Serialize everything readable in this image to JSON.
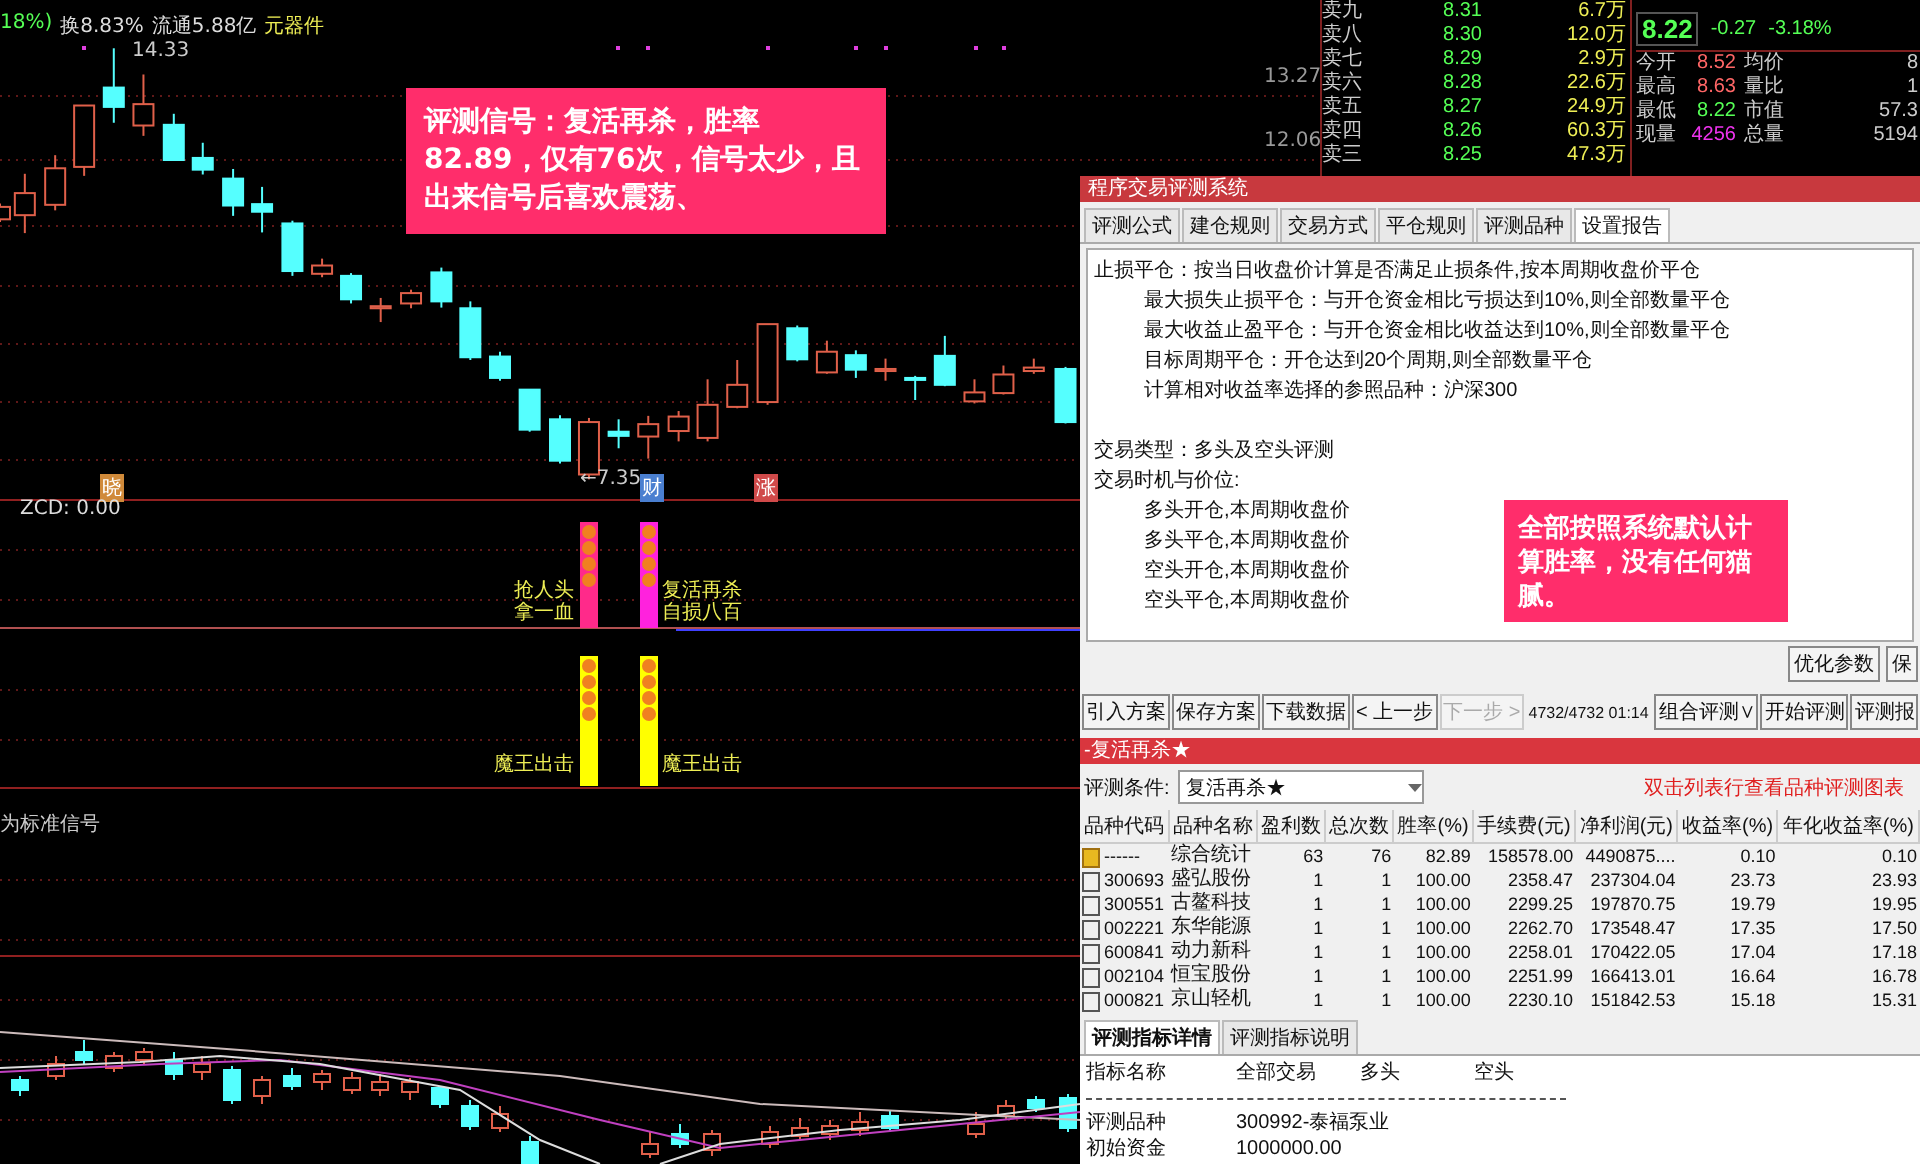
{
  "chart": {
    "header": [
      {
        "text": "18%)",
        "kind": "change"
      },
      {
        "text": "换8.83%",
        "kind": "plain"
      },
      {
        "text": "流通5.88亿",
        "kind": "plain"
      },
      {
        "text": "元器件",
        "kind": "sector"
      }
    ],
    "high_label": "14.33",
    "low_label": "←7.35",
    "axis_labels": [
      "13.27",
      "12.06"
    ],
    "markers": [
      {
        "text": "晓",
        "color": "#d08a3a"
      },
      {
        "text": "财",
        "color": "#4a7fd0"
      },
      {
        "text": "涨",
        "color": "#d04a4a"
      }
    ],
    "note": "评测信号：复活再杀，胜率82.89，仅有76次，信号太少，且出来信号后喜欢震荡、"
  },
  "indicator": {
    "title": "ZCD: 0.00",
    "signals": [
      {
        "line1": "抢人头",
        "line2": "拿一血",
        "color": "#ff2a8a"
      },
      {
        "line1": "复活再杀",
        "line2": "自损八百",
        "color": "#ff22dd"
      }
    ],
    "lower_signals": [
      "魔王出击",
      "魔王出击"
    ],
    "caption": "为标准信号"
  },
  "quote": {
    "asks": [
      {
        "label": "卖九",
        "price": "8.31",
        "volume": "6.7万"
      },
      {
        "label": "卖八",
        "price": "8.30",
        "volume": "12.0万"
      },
      {
        "label": "卖七",
        "price": "8.29",
        "volume": "2.9万"
      },
      {
        "label": "卖六",
        "price": "8.28",
        "volume": "22.6万"
      },
      {
        "label": "卖五",
        "price": "8.27",
        "volume": "24.9万"
      },
      {
        "label": "卖四",
        "price": "8.26",
        "volume": "60.3万"
      },
      {
        "label": "卖三",
        "price": "8.25",
        "volume": "47.3万"
      }
    ],
    "price": "8.22",
    "change": "-0.27",
    "percent": "-3.18%",
    "stats": [
      {
        "label": "今开",
        "value": "8.52",
        "color": "#ff6666",
        "label2": "均价",
        "value2": "8"
      },
      {
        "label": "最高",
        "value": "8.63",
        "color": "#ff6666",
        "label2": "量比",
        "value2": "1"
      },
      {
        "label": "最低",
        "value": "8.22",
        "color": "#55ff55",
        "label2": "市值",
        "value2": "57.3"
      },
      {
        "label": "现量",
        "value": "4256",
        "color": "#ee33ee",
        "label2": "总量",
        "value2": "5194"
      }
    ]
  },
  "dialog": {
    "title": "程序交易评测系统",
    "tabs": [
      {
        "label": "评测公式",
        "selected": false
      },
      {
        "label": "建仓规则",
        "selected": false
      },
      {
        "label": "交易方式",
        "selected": false
      },
      {
        "label": "平仓规则",
        "selected": false
      },
      {
        "label": "评测品种",
        "selected": false
      },
      {
        "label": "设置报告",
        "selected": true
      }
    ],
    "report_lines": [
      {
        "text": "止损平仓：按当日收盘价计算是否满足止损条件,按本周期收盘价平仓",
        "kind": "heading"
      },
      {
        "text": "最大损失止损平仓：与开仓资金相比亏损达到10%,则全部数量平仓",
        "kind": "item"
      },
      {
        "text": "最大收益止盈平仓：与开仓资金相比收益达到10%,则全部数量平仓",
        "kind": "item"
      },
      {
        "text": "目标周期平仓：开仓达到20个周期,则全部数量平仓",
        "kind": "item"
      },
      {
        "text": "计算相对收益率选择的参照品种：沪深300",
        "kind": "item"
      },
      {
        "text": "交易类型：多头及空头评测",
        "kind": "section"
      },
      {
        "text": "交易时机与价位:",
        "kind": "heading"
      },
      {
        "text": "多头开仓,本周期收盘价",
        "kind": "item"
      },
      {
        "text": "多头平仓,本周期收盘价",
        "kind": "item"
      },
      {
        "text": "空头开仓,本周期收盘价",
        "kind": "item"
      },
      {
        "text": "空头平仓,本周期收盘价",
        "kind": "item"
      }
    ],
    "note": "全部按照系统默认计算胜率，没有任何猫腻。",
    "panel_buttons": [
      "优化参数",
      "保"
    ],
    "toolbar": [
      {
        "label": "引入方案",
        "disabled": false
      },
      {
        "label": "保存方案",
        "disabled": false
      },
      {
        "label": "下载数据",
        "disabled": false
      },
      {
        "label": "< 上一步",
        "disabled": false
      },
      {
        "label": "下一步 >",
        "disabled": true
      }
    ],
    "progress": "4732/4732  01:14",
    "toolbar_right": [
      "组合评测∨",
      "开始评测",
      "评测报"
    ],
    "strategy_bar": "-复活再杀★",
    "condition": {
      "label": "评测条件:",
      "value": "复活再杀★",
      "hint": "双击列表行查看品种评测图表"
    },
    "table": {
      "columns": [
        "品种代码",
        "品种名称",
        "盈利数",
        "总次数",
        "胜率(%)",
        "手续费(元)",
        "净利润(元)",
        "收益率(%)",
        "年化收益率(%)"
      ],
      "rows": [
        {
          "kind": "summary",
          "cells": [
            "------",
            "综合统计",
            "63",
            "76",
            "82.89",
            "158578.00",
            "4490875....",
            "0.10",
            "0.10"
          ]
        },
        {
          "kind": "stock",
          "checked": false,
          "cells": [
            "300693",
            "盛弘股份",
            "1",
            "1",
            "100.00",
            "2358.47",
            "237304.04",
            "23.73",
            "23.93"
          ]
        },
        {
          "kind": "stock",
          "checked": false,
          "cells": [
            "300551",
            "古鳌科技",
            "1",
            "1",
            "100.00",
            "2299.25",
            "197870.75",
            "19.79",
            "19.95"
          ]
        },
        {
          "kind": "stock",
          "checked": false,
          "cells": [
            "002221",
            "东华能源",
            "1",
            "1",
            "100.00",
            "2262.70",
            "173548.47",
            "17.35",
            "17.50"
          ]
        },
        {
          "kind": "stock",
          "checked": false,
          "cells": [
            "600841",
            "动力新科",
            "1",
            "1",
            "100.00",
            "2258.01",
            "170422.05",
            "17.04",
            "17.18"
          ]
        },
        {
          "kind": "stock",
          "checked": false,
          "cells": [
            "002104",
            "恒宝股份",
            "1",
            "1",
            "100.00",
            "2251.99",
            "166413.01",
            "16.64",
            "16.78"
          ]
        },
        {
          "kind": "stock",
          "checked": false,
          "cells": [
            "000821",
            "京山轻机",
            "1",
            "1",
            "100.00",
            "2230.10",
            "151842.53",
            "15.18",
            "15.31"
          ]
        }
      ]
    },
    "detail_tabs": [
      {
        "label": "评测指标详情",
        "selected": true
      },
      {
        "label": "评测指标说明",
        "selected": false
      }
    ],
    "detail": {
      "headers": [
        "指标名称",
        "全部交易",
        "多头",
        "空头"
      ],
      "rows": [
        {
          "label": "评测品种",
          "value": "300992-泰福泵业"
        },
        {
          "label": "初始资金",
          "value": "1000000.00"
        }
      ]
    }
  }
}
